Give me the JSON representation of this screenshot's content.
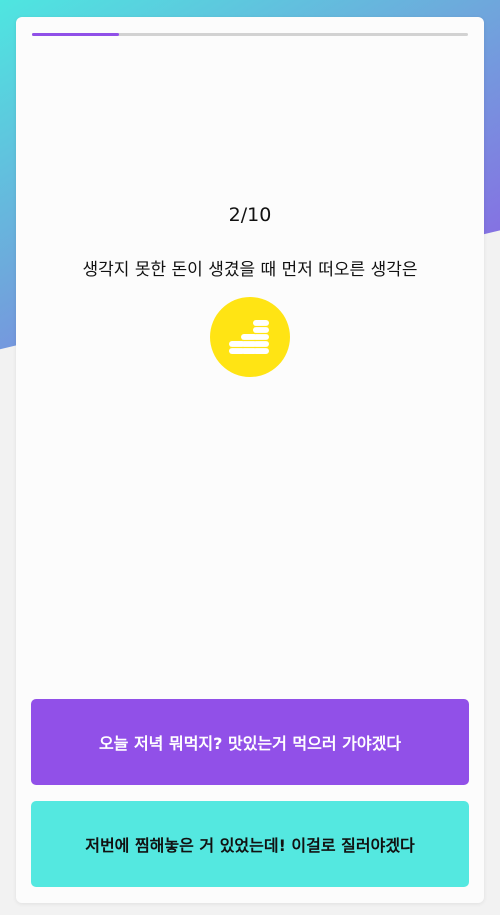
{
  "quiz": {
    "progress": 0.2,
    "counter": "2/10",
    "question": "생각지 못한 돈이 생겼을 때 먼저 떠오른 생각은",
    "icon": "coins-icon",
    "icon_bg_color": "#ffe414",
    "answers": [
      {
        "label": "오늘 저녁 뭐먹지? 맛있는거 먹으러 가야겠다",
        "color": "#9150e8"
      },
      {
        "label": "저번에 찜해놓은 거 있었는데! 이걸로 질러야겠다",
        "color": "#54e8e0"
      }
    ]
  },
  "colors": {
    "accent": "#9150e8",
    "secondary": "#54e8e0"
  }
}
